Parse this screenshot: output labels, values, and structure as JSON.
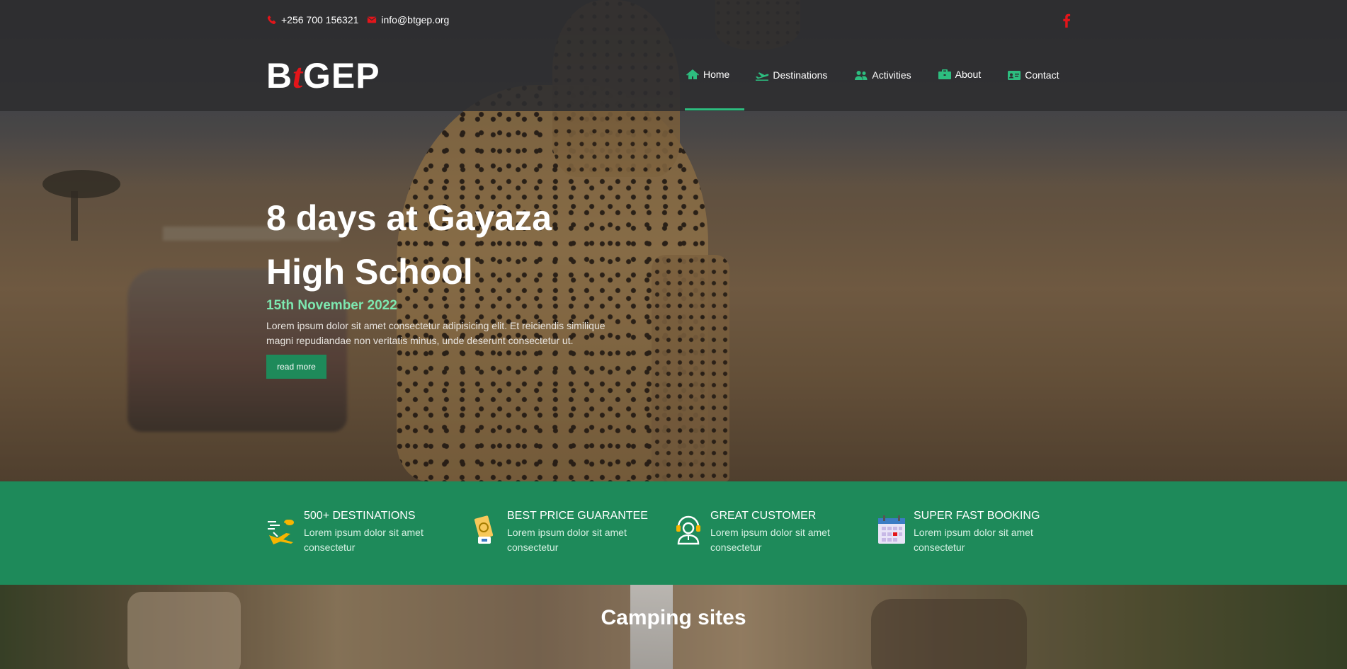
{
  "contact": {
    "phone": "+256 700 156321",
    "email": "info@btgep.org"
  },
  "logo": {
    "part1": "B",
    "part2": "t",
    "part3": "GEP"
  },
  "nav": [
    {
      "label": "Home",
      "icon": "home-icon",
      "active": true
    },
    {
      "label": "Destinations",
      "icon": "plane-icon"
    },
    {
      "label": "Activities",
      "icon": "users-icon"
    },
    {
      "label": "About",
      "icon": "briefcase-icon"
    },
    {
      "label": "Contact",
      "icon": "id-card-icon"
    }
  ],
  "hero": {
    "title": "8 days at Gayaza High School",
    "date": "15th November 2022",
    "description": "Lorem ipsum dolor sit amet consectetur adipisicing elit. Et reiciendis similique magni repudiandae non veritatis minus, unde deserunt consectetur ut.",
    "button": "read more"
  },
  "features": [
    {
      "title": "500+ DESTINATIONS",
      "desc": "Lorem ipsum dolor sit amet consectetur",
      "icon": "travel-icon"
    },
    {
      "title": "BEST PRICE GUARANTEE",
      "desc": "Lorem ipsum dolor sit amet consectetur",
      "icon": "money-icon"
    },
    {
      "title": "GREAT CUSTOMER",
      "desc": "Lorem ipsum dolor sit amet consectetur",
      "icon": "support-agent-icon"
    },
    {
      "title": "SUPER FAST BOOKING",
      "desc": "Lorem ipsum dolor sit amet consectetur",
      "icon": "calendar-icon"
    }
  ],
  "camping": {
    "title": "Camping sites"
  },
  "colors": {
    "accent": "#1e8a5a",
    "brand_red": "#e3151a",
    "active_underline": "#2dbd7f",
    "date": "#7de8b0"
  }
}
